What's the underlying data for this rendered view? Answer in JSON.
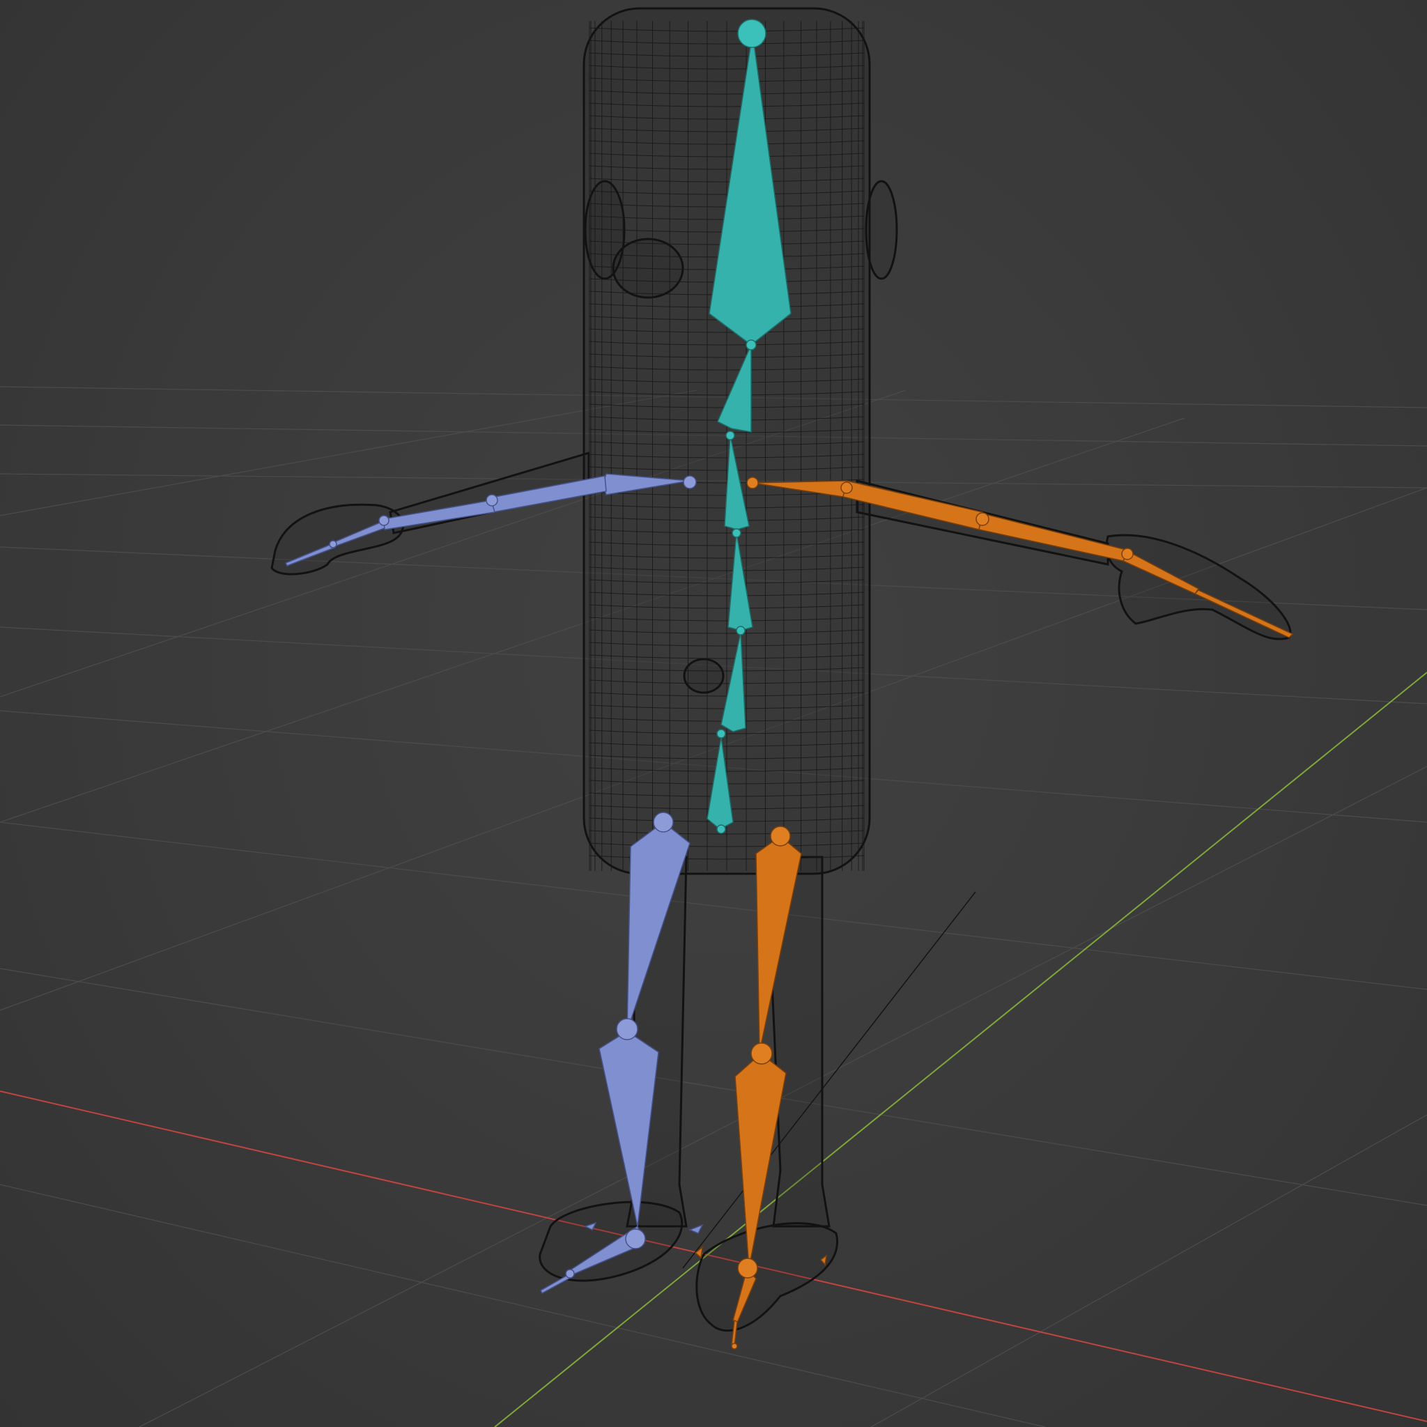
{
  "viewport": {
    "mode": "wireframe",
    "background": "#3c3c3c",
    "grid_color": "#4b4b4b",
    "axis_x_color": "#c0443f",
    "axis_y_color": "#7fa73b"
  },
  "mesh": {
    "wire_color": "#121212",
    "parts": [
      "body",
      "left-arm",
      "right-arm",
      "left-hand",
      "right-hand",
      "left-leg",
      "right-leg",
      "left-foot",
      "right-foot",
      "left-ear",
      "right-ear",
      "eye-socket"
    ]
  },
  "armature": {
    "colors": {
      "center": "#36b2ad",
      "left": "#7f8fd0",
      "right": "#d67419"
    },
    "bone_groups": [
      "spine",
      "left-arm",
      "right-arm",
      "left-leg",
      "right-leg"
    ]
  }
}
